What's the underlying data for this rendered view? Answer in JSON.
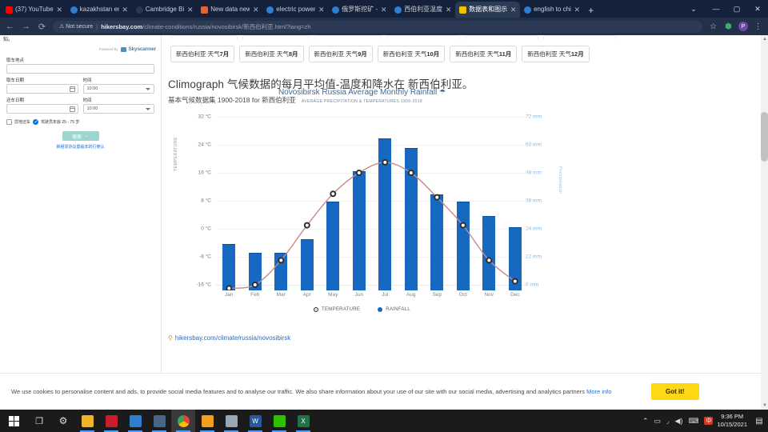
{
  "window": {
    "controls": {
      "chevron": "⌄",
      "minimize": "—",
      "maximize": "▢",
      "close": "✕"
    }
  },
  "tabs": [
    {
      "title": "(37) YouTube",
      "favicon_color": "#ff0000",
      "active": false
    },
    {
      "title": "kazakhstan en",
      "favicon_color": "#2f7fd1",
      "active": false
    },
    {
      "title": "Cambridge Bi",
      "favicon_color": "#1b2738",
      "active": false
    },
    {
      "title": "New data new",
      "favicon_color": "#e8622c",
      "active": false
    },
    {
      "title": "electric power",
      "favicon_color": "#2f7fd1",
      "active": false
    },
    {
      "title": "俄罗斯挖矿 -",
      "favicon_color": "#2f7fd1",
      "active": false
    },
    {
      "title": "西伯利亚温度",
      "favicon_color": "#2f7fd1",
      "active": false
    },
    {
      "title": "数据表和图示",
      "favicon_color": "#f2c200",
      "active": true
    },
    {
      "title": "english to chi",
      "favicon_color": "#2f7fd1",
      "active": false
    }
  ],
  "newtab_label": "+",
  "toolbar": {
    "back": "←",
    "forward": "→",
    "reload": "⟳",
    "security_label": "Not secure",
    "warning_icon": "⚠",
    "separator": "|",
    "url_domain": "hikersbay.com",
    "url_path": "/climate-conditions/russia/novosibirsk/新西伯利亚.html?lang=zh",
    "bookmark_icon": "☆",
    "extension_icon": "▦",
    "profile_initial": "P",
    "menu_icon": "⋮"
  },
  "sidebar": {
    "top_text": "知。",
    "powered_by": "Powered by",
    "brand": "Skyscanner",
    "fields": [
      {
        "label": "取车地点",
        "value": "",
        "type": "text"
      },
      {
        "label": "取车日期",
        "value": "",
        "type": "date"
      },
      {
        "label": "时间",
        "value": "10:00",
        "type": "select"
      },
      {
        "label": "还车日期",
        "value": "",
        "type": "date"
      },
      {
        "label": "时间",
        "value": "10:00",
        "type": "select"
      }
    ],
    "checkbox_1_label": "异地还车",
    "checkbox_2_label": "驾驶员年龄 25 - 75 岁",
    "checkbox_1_checked": false,
    "checkbox_2_checked": true,
    "search_button": "搜索",
    "search_button_arrow": "→",
    "note": "新租赁协议置临本的行使认"
  },
  "month_pills": [
    {
      "prefix": "新西伯利亚 天气",
      "num": "7月"
    },
    {
      "prefix": "新西伯利亚 天气",
      "num": "8月"
    },
    {
      "prefix": "新西伯利亚 天气",
      "num": "9月"
    },
    {
      "prefix": "新西伯利亚 天气",
      "num": "10月"
    },
    {
      "prefix": "新西伯利亚 天气",
      "num": "11月"
    },
    {
      "prefix": "新西伯利亚 天气",
      "num": "12月"
    }
  ],
  "page": {
    "heading": "Climograph 气候数据的每月平均值-温度和降水在 新西伯利亚。",
    "subheading": "基本气候数据集 1900-2018 for 新西伯利亚",
    "source_link": "hikersbay.com/climate/russia/novosibirsk",
    "pin_icon": "⚲"
  },
  "chart_data": {
    "type": "bar",
    "title": "Novosibirsk Russia Average Monthly Rainfall",
    "title_icon": "☂",
    "subtitle": "AVERAGE PRECIPITATION & TEMPERATURES 1900-2018",
    "categories": [
      "Jan",
      "Feb",
      "Mar",
      "Apr",
      "May",
      "Jun",
      "Jul",
      "Aug",
      "Sep",
      "Oct",
      "Nov",
      "Dec"
    ],
    "series": [
      {
        "name": "RAINFALL",
        "type": "bar",
        "unit": "mm",
        "color": "#1668c0",
        "values": [
          20,
          16,
          16,
          22,
          38,
          51,
          65,
          61,
          41,
          38,
          32,
          27
        ]
      },
      {
        "name": "TEMPERATURE",
        "type": "line",
        "unit": "°C",
        "color": "#c98a86",
        "values": [
          -17,
          -16,
          -9,
          1,
          10,
          16,
          19,
          16,
          9,
          1,
          -9,
          -15
        ]
      }
    ],
    "left_axis": {
      "label": "TEMPERATURE",
      "ticks": [
        "32 °C",
        "24 °C",
        "16 °C",
        "8 °C",
        "0 °C",
        "-8 °C",
        "-16 °C"
      ],
      "min": -16,
      "max": 32
    },
    "right_axis": {
      "label": "Precipitation",
      "ticks": [
        "72 mm",
        "60 mm",
        "48 mm",
        "36 mm",
        "24 mm",
        "12 mm",
        "0 mm"
      ],
      "min": 0,
      "max": 72
    },
    "legend": [
      {
        "label": "TEMPERATURE",
        "marker": "ring"
      },
      {
        "label": "RAINFALL",
        "marker": "dot"
      }
    ],
    "legend_position": "bottom",
    "grid": true
  },
  "cookie_banner": {
    "text": "We use cookies to personalise content and ads, to provide social media features and to analyse our traffic. We also share information about your use of our site with our social media, advertising and analytics partners ",
    "link": "More info",
    "button": "Got it!"
  },
  "taskbar": {
    "start": "⊞",
    "task_view": "❐",
    "settings_icon": "⚙",
    "apps": [
      {
        "name": "file-explorer",
        "color": "#f0b429",
        "glyph": "📁"
      },
      {
        "name": "pdf-reader",
        "color": "#c8202a",
        "glyph": "■"
      },
      {
        "name": "browser-blue",
        "color": "#2f7fd1",
        "glyph": "●"
      },
      {
        "name": "remote-desktop",
        "color": "#4a6484",
        "glyph": "■"
      },
      {
        "name": "chrome",
        "color": "#e8eaed",
        "glyph": "◉"
      },
      {
        "name": "media-player",
        "color": "#f0a020",
        "glyph": "▶"
      },
      {
        "name": "folder-app",
        "color": "#9aa7b5",
        "glyph": "▤"
      },
      {
        "name": "word",
        "color": "#2b579a",
        "glyph": "W"
      },
      {
        "name": "wechat",
        "color": "#2dc100",
        "glyph": "✆"
      },
      {
        "name": "excel",
        "color": "#217346",
        "glyph": "X"
      }
    ],
    "tray": [
      "⌃",
      "▭",
      "◞",
      "◀)",
      "⌨"
    ],
    "ime_icon": "中",
    "time": "9:36 PM",
    "date": "10/15/2021",
    "notification_icon": "▤"
  }
}
